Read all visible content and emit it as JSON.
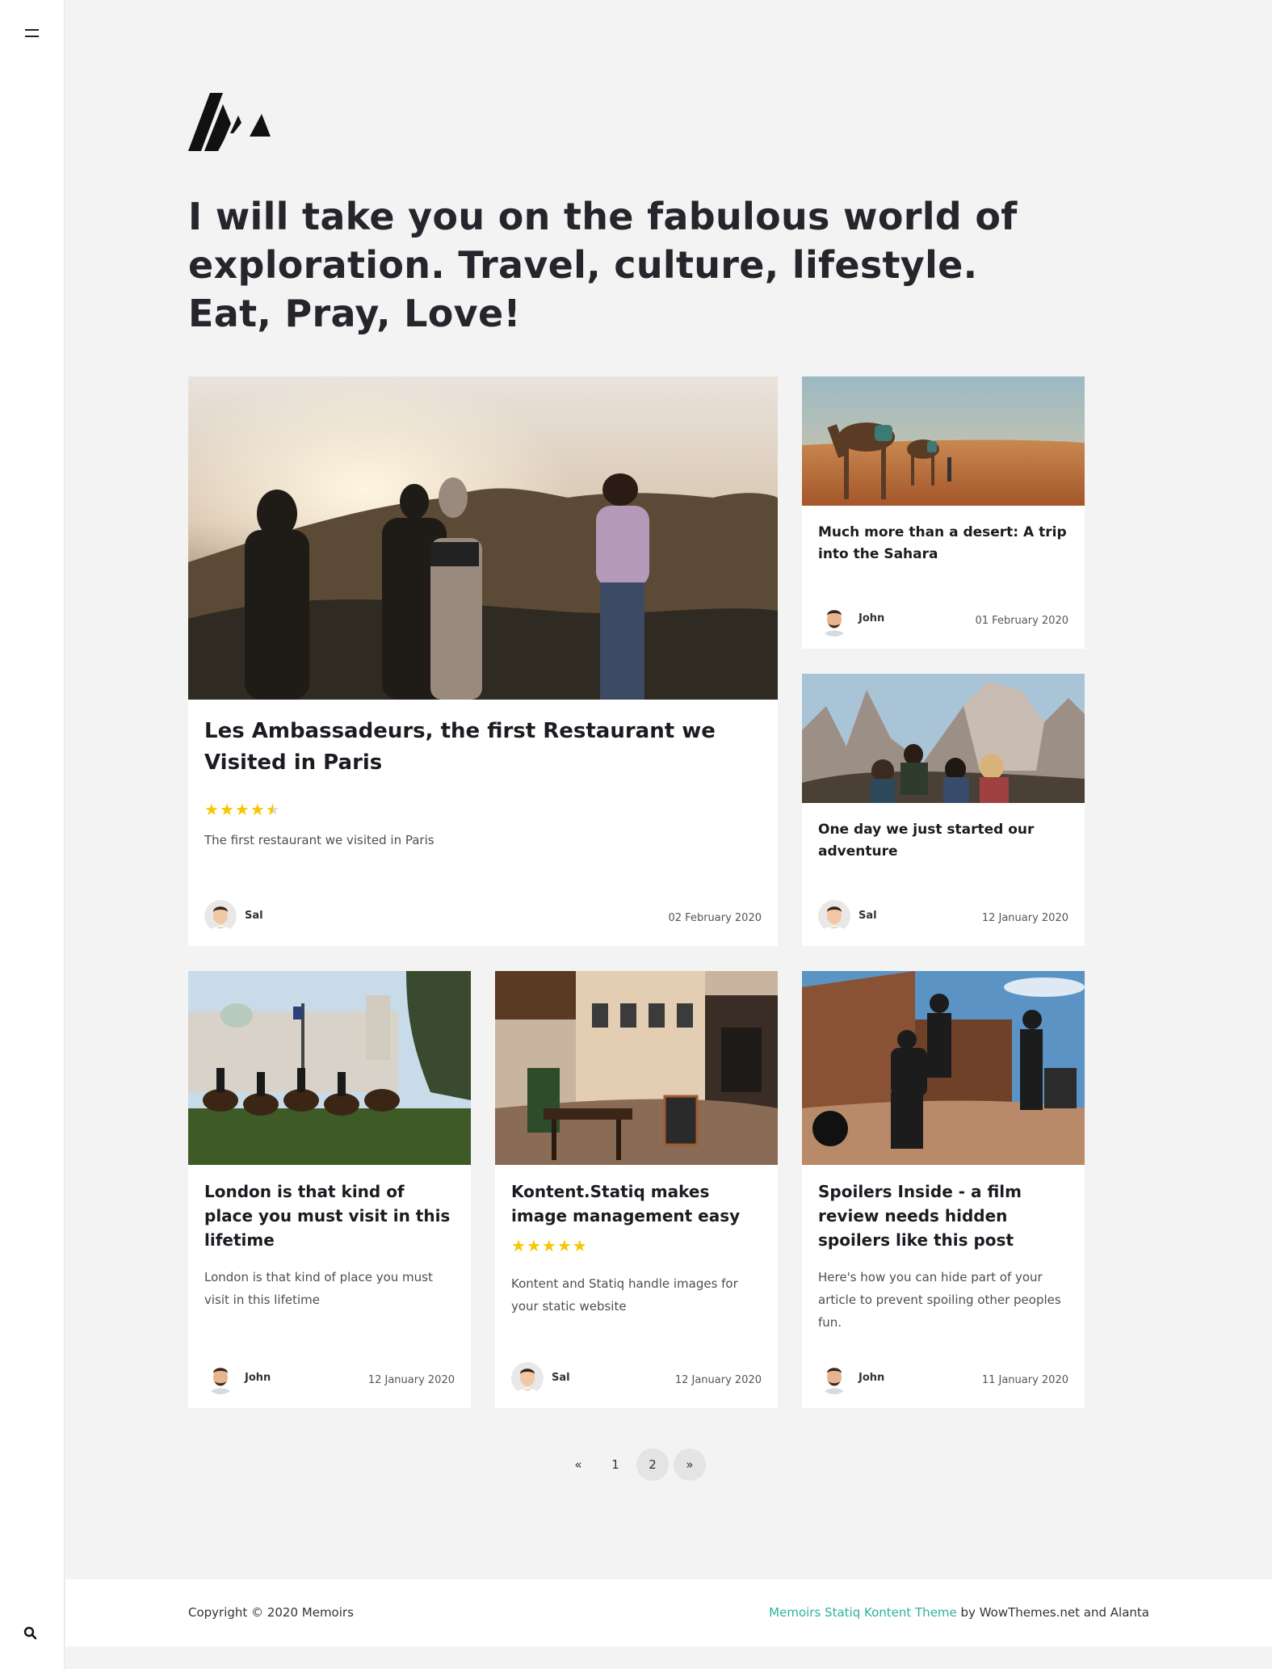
{
  "site": {
    "hero_title": "I will take you on the fabulous world of exploration. Travel, culture, lifestyle. Eat, Pray, Love!"
  },
  "icons": {
    "menu": "hamburger-icon",
    "search": "search-icon",
    "logo": "memoirs-logo"
  },
  "colors": {
    "background": "#f3f3f3",
    "card": "#ffffff",
    "star": "#f7c600",
    "link_accent": "#2bb49a"
  },
  "posts": [
    {
      "title": "Les Ambassadeurs, the first Restaurant we Visited in Paris",
      "rating": 4.5,
      "stars": "★★★★★",
      "excerpt": "The first restaurant we visited in Paris",
      "author": "Sal",
      "date": "02 February 2020"
    },
    {
      "title": "Much more than a desert: A trip into the Sahara",
      "author": "John",
      "date": "01 February 2020"
    },
    {
      "title": "One day we just started our adventure",
      "author": "Sal",
      "date": "12 January 2020"
    },
    {
      "title": "London is that kind of place you must visit in this lifetime",
      "excerpt": "London is that kind of place you must visit in this lifetime",
      "author": "John",
      "date": "12 January 2020"
    },
    {
      "title": "Kontent.Statiq makes image management easy",
      "rating": 5,
      "stars": "★★★★★",
      "excerpt": "Kontent and Statiq handle images for your static website",
      "author": "Sal",
      "date": "12 January 2020"
    },
    {
      "title": "Spoilers Inside - a film review needs hidden spoilers like this post",
      "excerpt": "Here's how you can hide part of your article to prevent spoiling other peoples fun.",
      "author": "John",
      "date": "11 January 2020"
    }
  ],
  "pagination": {
    "prev": "«",
    "pages": [
      "1",
      "2"
    ],
    "current": "2",
    "next": "»"
  },
  "footer": {
    "copyright": "Copyright © 2020 Memoirs",
    "theme_link": "Memoirs Statiq Kontent Theme",
    "credits_rest": " by WowThemes.net and Alanta"
  }
}
